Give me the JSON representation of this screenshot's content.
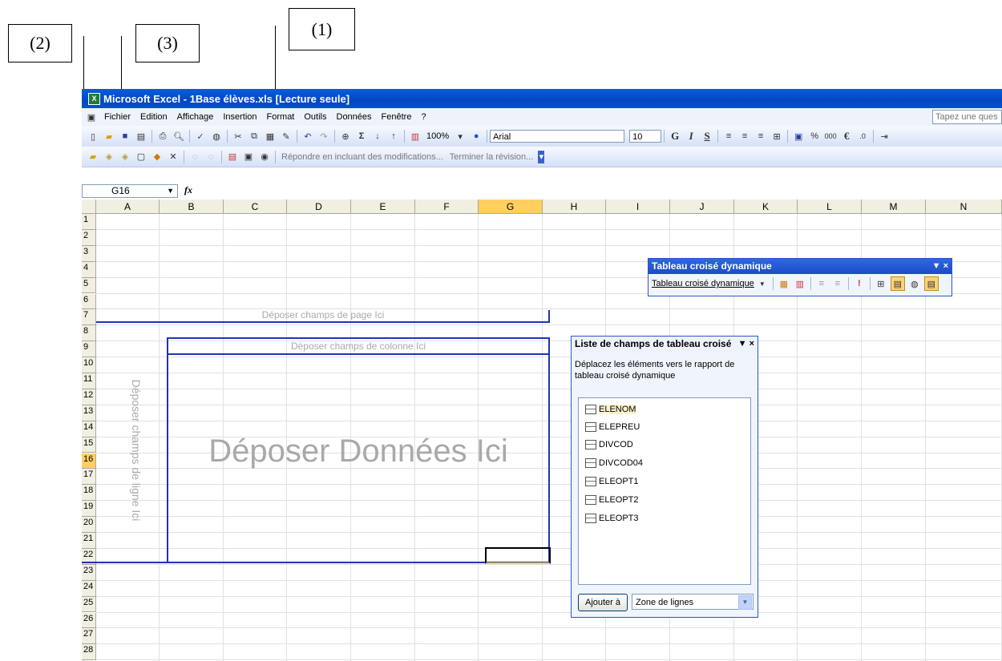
{
  "callouts": [
    {
      "label": "(2)"
    },
    {
      "label": "(3)"
    },
    {
      "label": "(1)"
    }
  ],
  "window": {
    "title": "Microsoft Excel - 1Base élèves.xls  [Lecture seule]"
  },
  "menu": {
    "items": [
      "Fichier",
      "Edition",
      "Affichage",
      "Insertion",
      "Format",
      "Outils",
      "Données",
      "Fenêtre",
      "?"
    ],
    "help_placeholder": "Tapez une ques"
  },
  "toolbar": {
    "zoom": "100%",
    "font": "Arial",
    "font_size": "10",
    "bold": "G",
    "italic": "I",
    "underline": "S",
    "percent": "%",
    "thousands": "000",
    "euro": "€"
  },
  "review_toolbar": {
    "reply_label": "Répondre en incluant des modifications...",
    "end_label": "Terminer la révision..."
  },
  "formula_bar": {
    "name_box": "G16",
    "fx": "fx"
  },
  "columns": [
    "A",
    "B",
    "C",
    "D",
    "E",
    "F",
    "G",
    "H",
    "I",
    "J",
    "K",
    "L",
    "M",
    "N"
  ],
  "rows": [
    "1",
    "2",
    "3",
    "4",
    "5",
    "6",
    "7",
    "8",
    "9",
    "10",
    "11",
    "12",
    "13",
    "14",
    "15",
    "16",
    "17",
    "18",
    "19",
    "20",
    "21",
    "22",
    "23",
    "24",
    "25",
    "26",
    "27",
    "28"
  ],
  "selected": {
    "column": "G",
    "row": "16"
  },
  "pivot": {
    "page_drop": "Déposer champs de page Ici",
    "column_drop": "Déposer champs de colonne Ici",
    "row_drop": "Déposer champs de ligne Ici",
    "data_drop": "Déposer Données Ici"
  },
  "pivot_toolbar": {
    "title": "Tableau croisé dynamique",
    "menu_label": "Tableau croisé dynamique",
    "controls": "▼ ×"
  },
  "field_list": {
    "title": "Liste de champs de tableau croisé",
    "controls": "▼ ×",
    "instruction": "Déplacez les éléments vers le rapport de tableau croisé dynamique",
    "fields": [
      "ELENOM",
      "ELEPREU",
      "DIVCOD",
      "DIVCOD04",
      "ELEOPT1",
      "ELEOPT2",
      "ELEOPT3"
    ],
    "add_button": "Ajouter à",
    "area_select": "Zone de lignes"
  }
}
